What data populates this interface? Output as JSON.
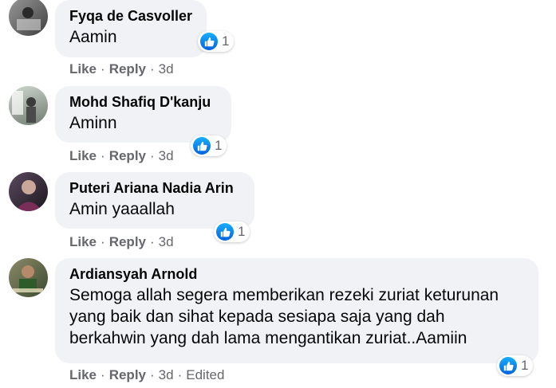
{
  "comments": [
    {
      "author": "Fyqa de Casvoller",
      "text": "Aamin",
      "reaction_count": "1",
      "like_label": "Like",
      "reply_label": "Reply",
      "time": "3d"
    },
    {
      "author": "Mohd Shafiq D'kanju",
      "text": "Aminn",
      "reaction_count": "1",
      "like_label": "Like",
      "reply_label": "Reply",
      "time": "3d"
    },
    {
      "author": "Puteri Ariana Nadia Arin",
      "text": "Amin yaaallah",
      "reaction_count": "1",
      "like_label": "Like",
      "reply_label": "Reply",
      "time": "3d"
    },
    {
      "author": "Ardiansyah Arnold",
      "text_lines": [
        "Semoga allah segera memberikan rezeki zuriat keturunan",
        "yang baik dan sihat kepada sesiapa saja yang dah",
        "berkahwin yang dah lama mengantikan zuriat..Aamiin"
      ],
      "reaction_count": "1",
      "like_label": "Like",
      "reply_label": "Reply",
      "time": "3d",
      "edited_label": "Edited"
    }
  ],
  "colors": {
    "bubble": "#f0f2f5",
    "meta_text": "#65676b",
    "like_blue": "#1877f2"
  },
  "icons": {
    "reaction": "like-thumb-icon"
  }
}
